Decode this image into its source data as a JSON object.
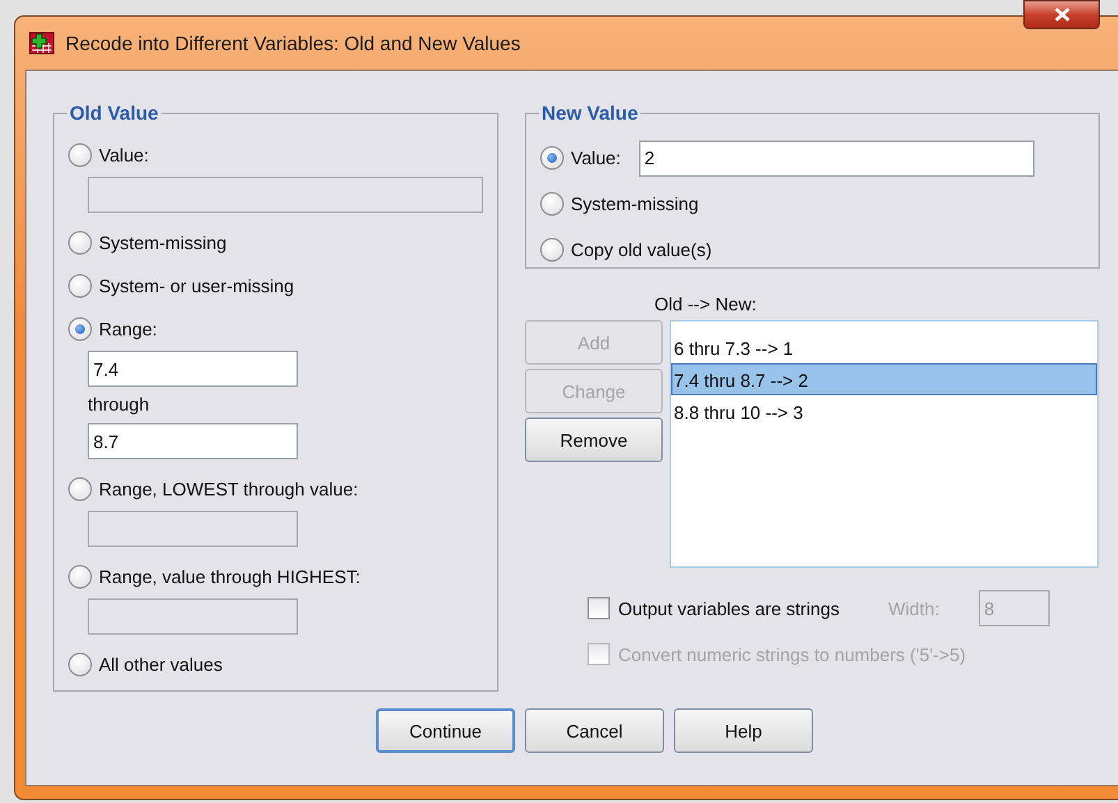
{
  "window": {
    "title": "Recode into Different Variables: Old and New Values"
  },
  "old_value": {
    "title": "Old Value",
    "options": [
      {
        "kind": "field",
        "label": "Value:",
        "selected": false,
        "fields": [
          {
            "disabled": true
          }
        ]
      },
      {
        "kind": "plain",
        "label": "System-missing",
        "selected": false
      },
      {
        "kind": "plain",
        "label": "System- or user-missing",
        "selected": false
      },
      {
        "kind": "range",
        "label": "Range:",
        "selected": true,
        "through": "through",
        "fields": [
          {
            "value": "7.4",
            "disabled": false
          },
          {
            "value": "8.7",
            "disabled": false
          }
        ]
      },
      {
        "kind": "field",
        "label": "Range, LOWEST through value:",
        "selected": false,
        "fields": [
          {
            "disabled": true
          }
        ]
      },
      {
        "kind": "field",
        "label": "Range, value through HIGHEST:",
        "selected": false,
        "fields": [
          {
            "disabled": true
          }
        ]
      },
      {
        "kind": "plain",
        "label": "All other values",
        "selected": false
      }
    ]
  },
  "new_value": {
    "title": "New Value",
    "options": [
      {
        "kind": "field",
        "label": "Value:",
        "selected": true,
        "value": "2"
      },
      {
        "kind": "plain",
        "label": "System-missing",
        "selected": false
      },
      {
        "kind": "plain",
        "label": "Copy old value(s)",
        "selected": false
      }
    ]
  },
  "mapping_label": "Old --> New:",
  "action_buttons": [
    {
      "label": "Add",
      "disabled": true
    },
    {
      "label": "Change",
      "disabled": true
    },
    {
      "label": "Remove",
      "disabled": false
    }
  ],
  "mappings": [
    {
      "text": "6 thru 7.3 --> 1",
      "selected": false
    },
    {
      "text": "7.4 thru 8.7 --> 2",
      "selected": true
    },
    {
      "text": "8.8 thru 10 --> 3",
      "selected": false
    }
  ],
  "output_strings": {
    "label": "Output variables are strings",
    "checked": false,
    "disabled": false
  },
  "width": {
    "label": "Width:",
    "value": "8",
    "disabled": true
  },
  "convert_numeric": {
    "label": "Convert numeric strings to numbers ('5'->5)",
    "checked": false,
    "disabled": true
  },
  "buttons": [
    {
      "label": "Continue",
      "default": true
    },
    {
      "label": "Cancel",
      "default": false
    },
    {
      "label": "Help",
      "default": false
    }
  ]
}
